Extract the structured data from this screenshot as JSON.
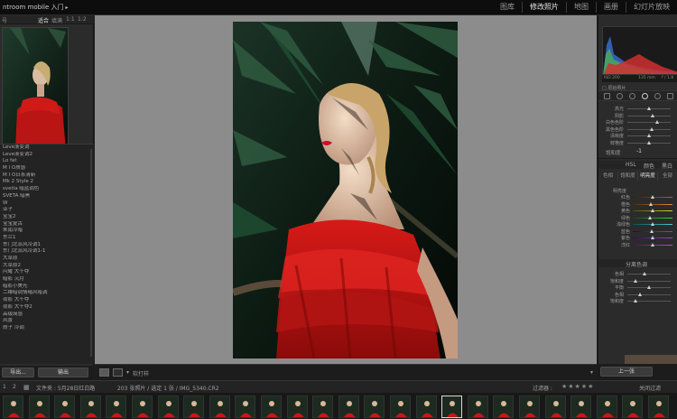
{
  "app": {
    "title": "ntroom mobile 入门",
    "title_arrow": "▸",
    "modules": [
      "图库",
      "修改照片",
      "地图",
      "画册",
      "幻灯片放映"
    ],
    "active_module": 1
  },
  "left_panel": {
    "nav_corner": "号",
    "nav_options": [
      "适合",
      "填满",
      "1:1",
      "1:2"
    ],
    "presets": [
      "Leve渐变调",
      "Leve渐变调2",
      "Lo fat",
      "M I O质感",
      "M I O日系清新",
      "Mk 2 Style 2",
      "svetla 暗蓝调色",
      "SVETA 暗黑",
      "W",
      "亚子",
      "宝宝2",
      "宝宝复古",
      "朱南冷暗",
      "东兰1",
      "东门北派风冷调1",
      "东门北派风冷调1-1",
      "大草原",
      "大草原2",
      "闪耀 大千夺",
      "暗影 沉月",
      "暗影小美光",
      "二维暗调情绪风暗调",
      "荷影 大千夺",
      "荷影 大千夺2",
      "高级简感",
      "风景",
      "质子 冷调"
    ],
    "import_button": "导出...",
    "export_button": "输出"
  },
  "center": {
    "soft_proof": "软打样",
    "arrow": "▾"
  },
  "right_panel": {
    "histogram_info": [
      "ISO 200",
      "135 mm",
      "f / 1.8"
    ],
    "original_photo": "原始照片",
    "tone_sliders": [
      {
        "label": "高光",
        "value": 0.52
      },
      {
        "label": "阴影",
        "value": 0.6
      },
      {
        "label": "白色色阶",
        "value": 0.7
      },
      {
        "label": "黑色色阶",
        "value": 0.58
      },
      {
        "label": "清晰度",
        "value": 0.5
      },
      {
        "label": "鲜艳度",
        "value": 0.5
      }
    ],
    "saturation": {
      "label": "饱和度",
      "value": "-1"
    },
    "hsl_header": [
      "HSL",
      "颜色",
      "黑白"
    ],
    "hsl_tabs": [
      "色相",
      "饱和度",
      "明亮度",
      "全部"
    ],
    "hsl_title": "明亮度",
    "hsl_sliders": [
      {
        "label": "红色",
        "value": 0.5
      },
      {
        "label": "橙色",
        "value": 0.46
      },
      {
        "label": "黄色",
        "value": 0.52
      },
      {
        "label": "绿色",
        "value": 0.44
      },
      {
        "label": "浅绿色",
        "value": 0.5
      },
      {
        "label": "蓝色",
        "value": 0.48
      },
      {
        "label": "紫色",
        "value": 0.5
      },
      {
        "label": "洋红",
        "value": 0.5
      }
    ],
    "split_header": "分离色调",
    "split_sliders": [
      {
        "label": "色相",
        "value": 0.4
      },
      {
        "label": "饱和度",
        "value": 0.2
      },
      {
        "label": "平衡",
        "value": 0.5
      },
      {
        "label": "色相",
        "value": 0.3
      },
      {
        "label": "饱和度",
        "value": 0.2
      }
    ],
    "reset_button": "上一张"
  },
  "filmstrip_bar": {
    "pages": [
      "1",
      "2"
    ],
    "path": "文件夹 : 5月28日红白路",
    "count": "203 张照片 / 选定 1 张 / IMG_5340.CR2",
    "filter_label": "过滤器 :",
    "stars": "★★★★★",
    "filter_off": "关闭过滤"
  }
}
